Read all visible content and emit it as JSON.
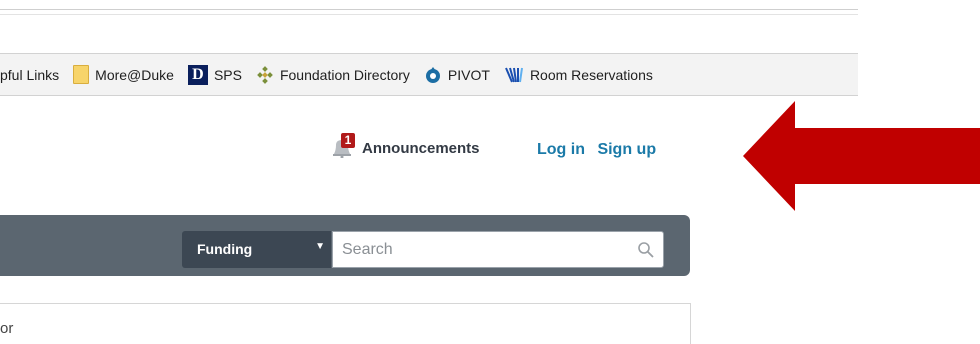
{
  "bookmarks": [
    {
      "label": "pful Links",
      "icon": "none"
    },
    {
      "label": "More@Duke",
      "icon": "folder-icon"
    },
    {
      "label": "SPS",
      "icon": "duke-d-logo-icon",
      "glyph": "D"
    },
    {
      "label": "Foundation Directory",
      "icon": "foundation-directory-icon"
    },
    {
      "label": "PIVOT",
      "icon": "pivot-icon"
    },
    {
      "label": "Room Reservations",
      "icon": "room-reservations-icon"
    }
  ],
  "header": {
    "announcements_label": "Announcements",
    "announcements_count": "1",
    "login_label": "Log in",
    "signup_label": "Sign up"
  },
  "search": {
    "category_value": "Funding",
    "placeholder": "Search"
  },
  "content": {
    "partial_text": "or"
  },
  "colors": {
    "accent_link": "#1b7aa8",
    "badge": "#b11a1a",
    "arrow": "#c00000",
    "search_bar": "#5b6670"
  }
}
